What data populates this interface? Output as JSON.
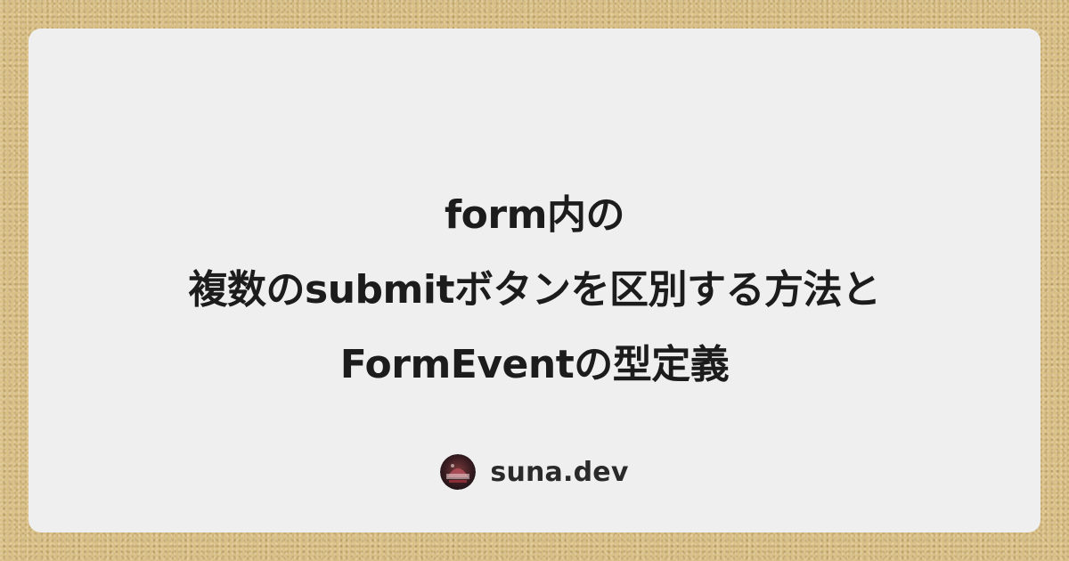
{
  "title": {
    "line1": "form内の",
    "line2": "複数のsubmitボタンを区別する方法と",
    "line3": "FormEventの型定義"
  },
  "author": {
    "name": "suna.dev",
    "avatar_icon": "avatar-logo-icon"
  },
  "colors": {
    "background": "#d8bf86",
    "card": "#efefef",
    "text": "#1c1c1c"
  }
}
